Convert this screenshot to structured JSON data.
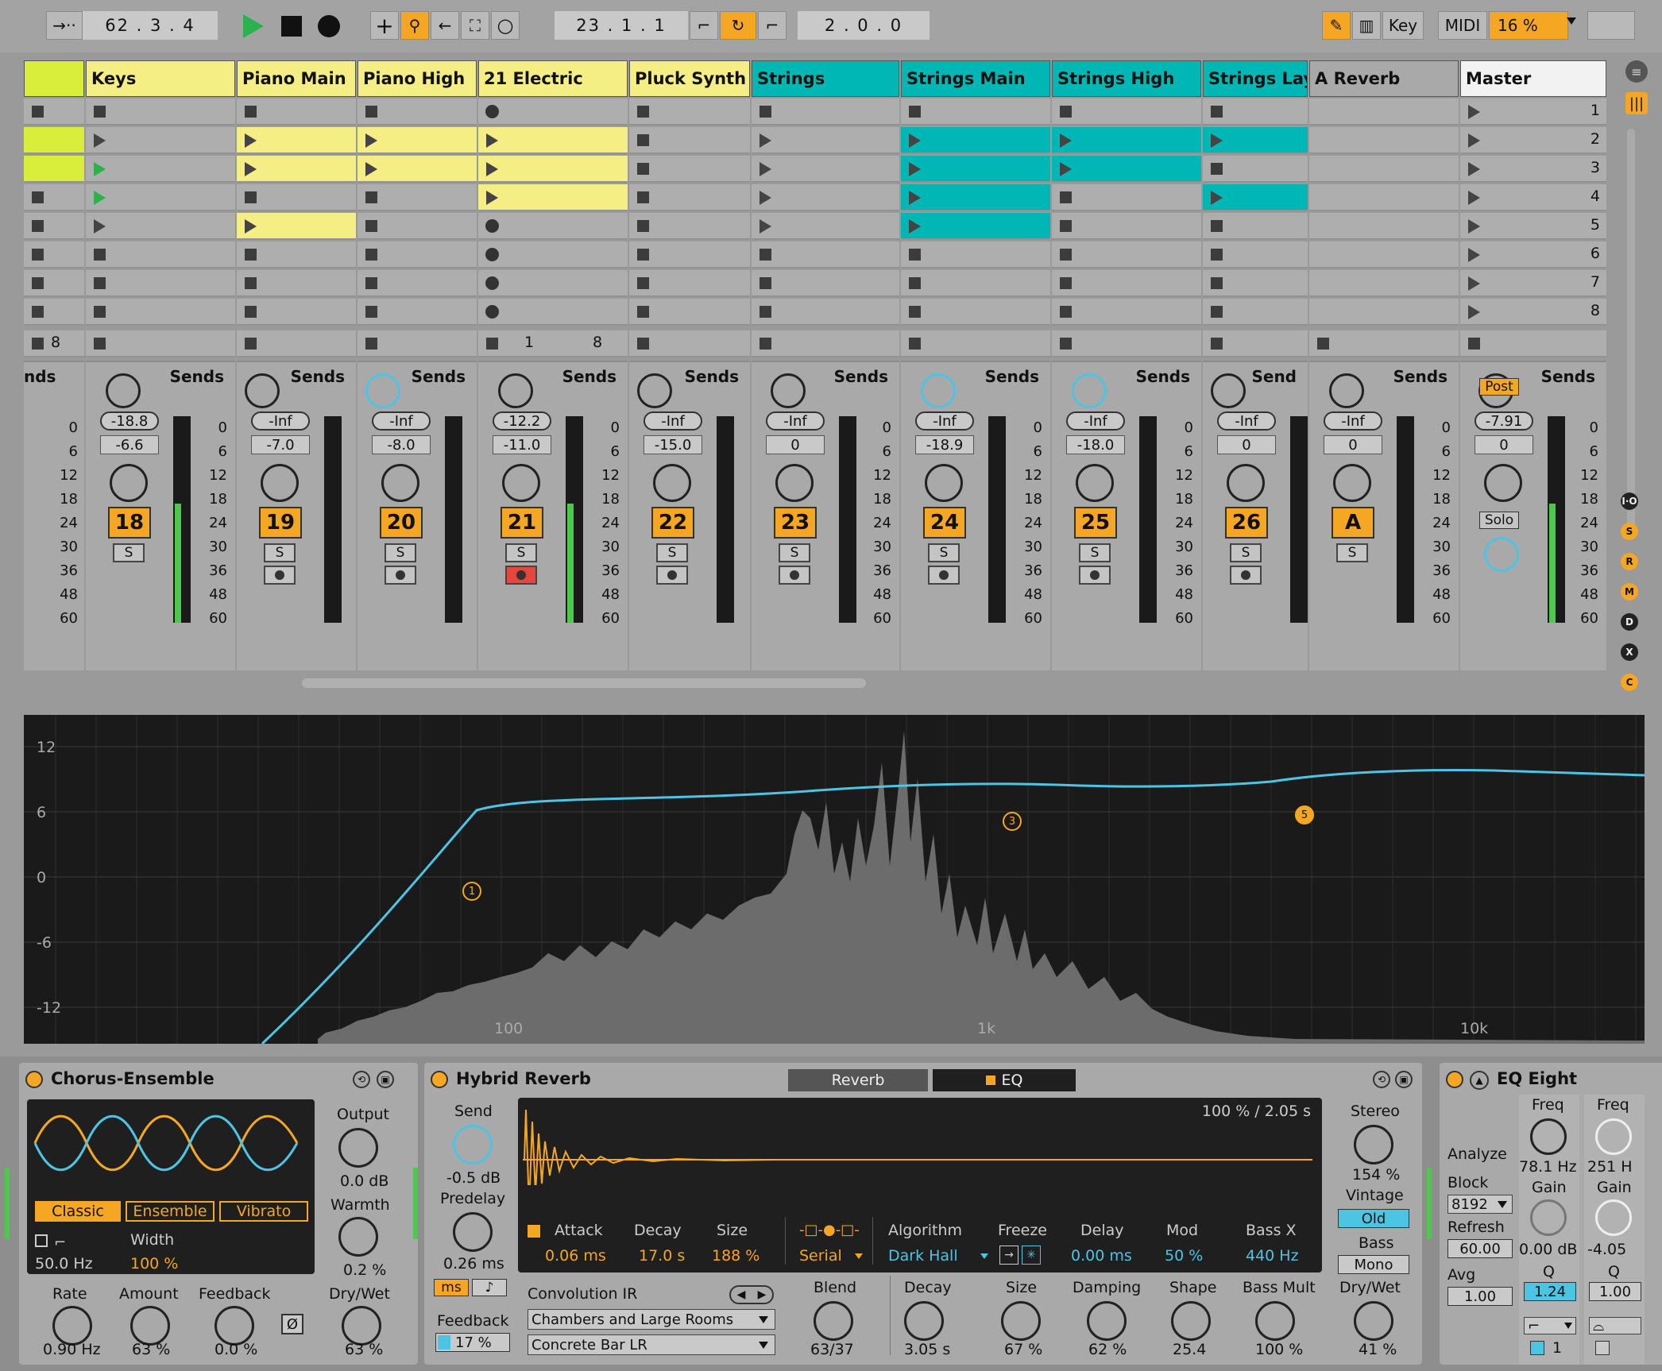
{
  "transport": {
    "position": "62 .  3 .  4",
    "loop_start": "23 .  1 .  1",
    "loop_length": "2 .  0 .  0",
    "key_label": "Key",
    "midi_label": "MIDI",
    "cpu": "16 %"
  },
  "tracks": [
    {
      "name": "",
      "color": "#d8ee3a",
      "number": "",
      "sends": "nds"
    },
    {
      "name": "Keys",
      "color": "#f5ee85",
      "number": "18",
      "vol": "-18.8",
      "pan": "-6.6",
      "sends": "Sends",
      "group_count": ""
    },
    {
      "name": "Piano Main",
      "color": "#f5ee85",
      "number": "19",
      "vol": "-Inf",
      "pan": "-7.0",
      "sends": "Sends"
    },
    {
      "name": "Piano High",
      "color": "#f5ee85",
      "number": "20",
      "vol": "-Inf",
      "pan": "-8.0",
      "sends": "Sends"
    },
    {
      "name": "21 Electric",
      "color": "#f5ee85",
      "number": "21",
      "vol": "-12.2",
      "pan": "-11.0",
      "sends": "Sends"
    },
    {
      "name": "Pluck Synth",
      "color": "#f5ee85",
      "number": "22",
      "vol": "-Inf",
      "pan": "-15.0",
      "sends": "Sends"
    },
    {
      "name": "Strings",
      "color": "#00b7b5",
      "number": "23",
      "vol": "-Inf",
      "pan": "0",
      "sends": "Sends"
    },
    {
      "name": "Strings Main",
      "color": "#00b7b5",
      "number": "24",
      "vol": "-Inf",
      "pan": "-18.9",
      "sends": "Sends"
    },
    {
      "name": "Strings High",
      "color": "#00b7b5",
      "number": "25",
      "vol": "-Inf",
      "pan": "-18.0",
      "sends": "Sends"
    },
    {
      "name": "Strings Laye",
      "color": "#00b7b5",
      "number": "26",
      "vol": "-Inf",
      "pan": "0",
      "sends": "Send"
    },
    {
      "name": "A Reverb",
      "color": "#a9a9a9",
      "number": "A",
      "vol": "-Inf",
      "pan": "0",
      "sends": "Sends"
    },
    {
      "name": "Master",
      "color": "#f2f2f2",
      "number": "",
      "vol": "-7.91",
      "pan": "0",
      "sends": "Sends",
      "post": "Post",
      "solo": "Solo"
    }
  ],
  "scenes": [
    "1",
    "2",
    "3",
    "4",
    "5",
    "6",
    "7",
    "8"
  ],
  "stop_row": {
    "first": "8",
    "electric_a": "1",
    "electric_b": "8"
  },
  "solo_label": "S",
  "meter_scale": [
    "0",
    "6",
    "12",
    "18",
    "24",
    "30",
    "36",
    "48",
    "60"
  ],
  "side_buttons": [
    "I·O",
    "S",
    "R",
    "M",
    "D",
    "X",
    "C"
  ],
  "eq_display": {
    "y_ticks": [
      "12",
      "6",
      "0",
      "-6",
      "-12"
    ],
    "x_ticks": [
      "100",
      "1k",
      "10k"
    ],
    "bands": [
      "1",
      "3",
      "5"
    ],
    "curve_color": "#4cc4e4"
  },
  "chorus": {
    "title": "Chorus-Ensemble",
    "modes": [
      "Classic",
      "Ensemble",
      "Vibrato"
    ],
    "width_label": "Width",
    "width_value": "100 %",
    "hz_value": "50.0 Hz",
    "output_label": "Output",
    "output_value": "0.0 dB",
    "warmth_label": "Warmth",
    "warmth_value": "0.2 %",
    "rate_label": "Rate",
    "rate_value": "0.90 Hz",
    "amount_label": "Amount",
    "amount_value": "63 %",
    "feedback_label": "Feedback",
    "feedback_value": "0.0 %",
    "phase_label": "Ø",
    "drywet_label": "Dry/Wet",
    "drywet_value": "63 %"
  },
  "reverb": {
    "title": "Hybrid Reverb",
    "tab_reverb": "Reverb",
    "tab_eq": "EQ",
    "send_label": "Send",
    "send_value": "-0.5 dB",
    "predelay_label": "Predelay",
    "predelay_value": "0.26 ms",
    "ms_label": "ms",
    "note_label": "♪",
    "feedback_label": "Feedback",
    "feedback_value": "17 %",
    "ir_readout": "100 %  / 2.05 s",
    "attack_label": "Attack",
    "attack_value": "0.06 ms",
    "decay_label": "Decay",
    "decay_value": "17.0 s",
    "size_label": "Size",
    "size_value": "188 %",
    "routing_value": "Serial",
    "algorithm_label": "Algorithm",
    "algorithm_value": "Dark Hall",
    "freeze_label": "Freeze",
    "delay_label": "Delay",
    "delay_value": "0.00 ms",
    "mod_label": "Mod",
    "mod_value": "50 %",
    "bassx_label": "Bass X",
    "bassx_value": "440 Hz",
    "conv_label": "Convolution IR",
    "ir_category": "Chambers and Large Rooms",
    "ir_name": "Concrete Bar LR",
    "blend_label": "Blend",
    "blend_value": "63/37",
    "decay2_label": "Decay",
    "decay2_value": "3.05 s",
    "size2_label": "Size",
    "size2_value": "67 %",
    "damping_label": "Damping",
    "damping_value": "62 %",
    "shape_label": "Shape",
    "shape_value": "25.4",
    "bassmult_label": "Bass Mult",
    "bassmult_value": "100 %",
    "stereo_label": "Stereo",
    "stereo_value": "154 %",
    "vintage_label": "Vintage",
    "vintage_value": "Old",
    "bass_label": "Bass",
    "bass_value": "Mono",
    "drywet_label": "Dry/Wet",
    "drywet_value": "41 %"
  },
  "eq8": {
    "title": "EQ Eight",
    "analyze_label": "Analyze",
    "block_label": "Block",
    "block_value": "8192",
    "refresh_label": "Refresh",
    "refresh_value": "60.00",
    "avg_label": "Avg",
    "avg_value": "1.00",
    "freq_label": "Freq",
    "freq_value": "78.1 Hz",
    "gain_label": "Gain",
    "gain_value": "0.00 dB",
    "q_label": "Q",
    "q_value": "1.24",
    "band_num": "1",
    "freq2_label": "Freq",
    "freq2_value": "251 H",
    "gain2_label": "Gain",
    "gain2_value": "-4.05",
    "q2_label": "Q",
    "q2_value": "1.00"
  }
}
